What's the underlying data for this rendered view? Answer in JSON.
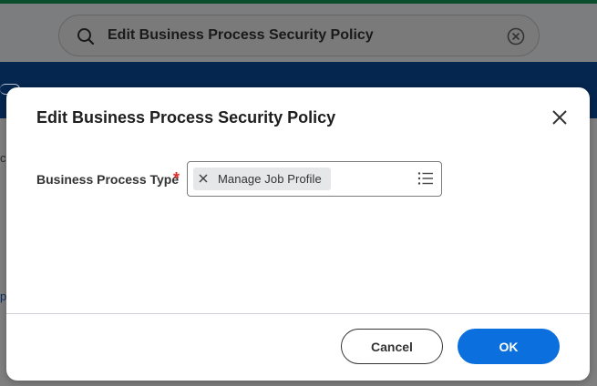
{
  "background": {
    "search": {
      "value": "Edit Business Process Security Policy",
      "search_icon": "search-icon",
      "clear_icon": "clear-circle-icon"
    },
    "fragment_left_1": "c",
    "fragment_left_2": "p"
  },
  "modal": {
    "title": "Edit Business Process Security Policy",
    "close_icon": "close-icon",
    "field": {
      "label": "Business Process Type",
      "required_marker": "*",
      "selected_items": [
        {
          "label": "Manage Job Profile",
          "remove_icon": "x-icon"
        }
      ],
      "prompt_icon": "list-icon"
    },
    "buttons": {
      "cancel": "Cancel",
      "ok": "OK"
    }
  },
  "colors": {
    "primary": "#0b6fde",
    "required": "#de2b24",
    "header_bar": "#05264f",
    "top_strip": "#0b4d2d",
    "overlay": "#7f7f7f"
  }
}
